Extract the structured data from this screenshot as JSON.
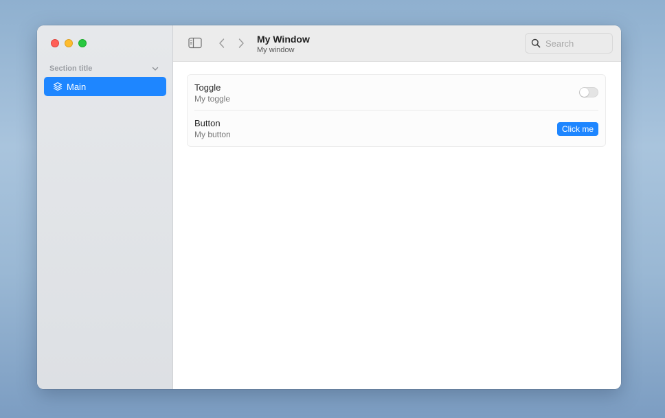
{
  "window": {
    "title": "My Window",
    "subtitle": "My window"
  },
  "sidebar": {
    "section_title": "Section title",
    "items": [
      {
        "label": "Main",
        "icon": "layers-icon",
        "selected": true
      }
    ]
  },
  "toolbar": {
    "search_placeholder": "Search",
    "search_value": ""
  },
  "settings": {
    "rows": [
      {
        "title": "Toggle",
        "subtitle": "My toggle",
        "control": "toggle",
        "value": false
      },
      {
        "title": "Button",
        "subtitle": "My button",
        "control": "button",
        "button_label": "Click me"
      }
    ]
  },
  "colors": {
    "accent": "#1e86ff",
    "close": "#ff5f57",
    "minimize": "#febc2e",
    "zoom": "#28c840"
  }
}
